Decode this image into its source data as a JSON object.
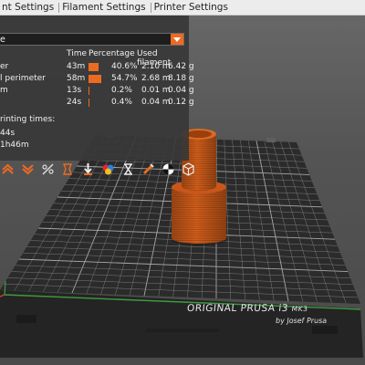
{
  "menu": {
    "items": [
      "nt Settings",
      "Filament Settings",
      "Printer Settings"
    ]
  },
  "legend": {
    "view_type": "e",
    "headers": {
      "time": "Time",
      "percentage": "Percentage",
      "used_filament": "Used filament"
    },
    "rows": [
      {
        "name": "er",
        "time": "43m",
        "percentage": "40.6%",
        "fraction": 0.406,
        "length": "2.10 m",
        "weight": "6.42 g",
        "color": "#ed6b21"
      },
      {
        "name": "l perimeter",
        "time": "58m",
        "percentage": "54.7%",
        "fraction": 0.547,
        "length": "2.68 m",
        "weight": "8.18 g",
        "color": "#ed6b21"
      },
      {
        "name": "m",
        "time": "13s",
        "percentage": "0.2%",
        "fraction": 0.002,
        "length": "0.01 m",
        "weight": "0.04 g",
        "color": "#ed6b21"
      },
      {
        "name": "",
        "time": "24s",
        "percentage": "0.4%",
        "fraction": 0.004,
        "length": "0.04 m",
        "weight": "0.12 g",
        "color": "#ed6b21"
      }
    ],
    "printing_times_label": "rinting times:",
    "printing_times": [
      "44s",
      "1h46m"
    ]
  },
  "toolbar": {
    "icons": [
      "retractions-icon",
      "deretractions-icon",
      "seams-icon",
      "tool-changes-icon",
      "color-changes-icon",
      "pause-prints-icon",
      "custom-gcode-icon",
      "center-of-gravity-icon",
      "shells-icon"
    ]
  },
  "bed": {
    "brand": "ORIGINAL PRUSA i3",
    "model": "MK3",
    "subtitle": "by Josef Prusa"
  },
  "colors": {
    "accent": "#ed6b21",
    "panel": "#383838",
    "bed": "#2b2b2b",
    "model": "#d2601d"
  }
}
